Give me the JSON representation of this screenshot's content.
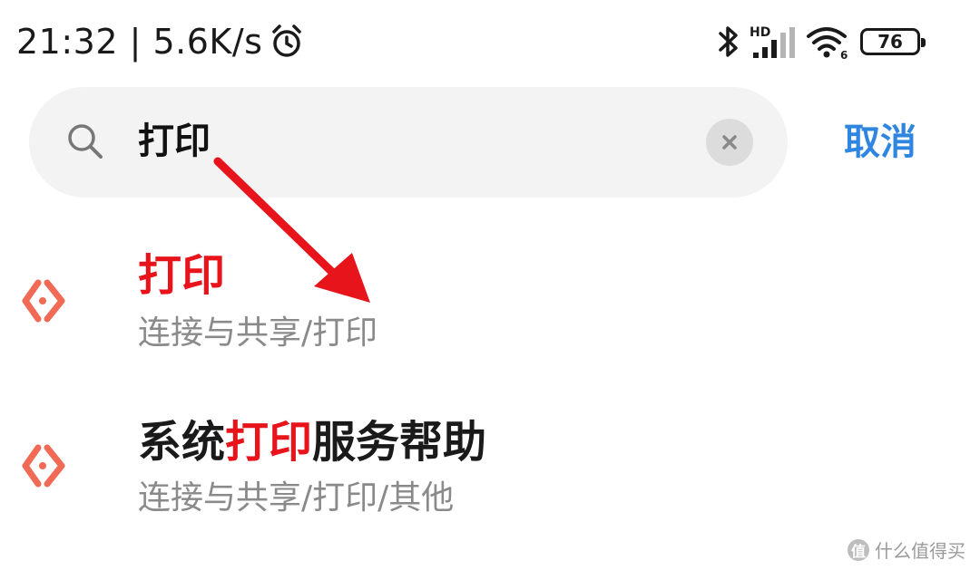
{
  "status_bar": {
    "time": "21:32",
    "network_speed": "5.6K/s",
    "battery": "76",
    "network_label": "HD",
    "wifi_label": "6",
    "icons": [
      "alarm-icon",
      "bluetooth-icon",
      "hd-signal-icon",
      "wifi-icon",
      "battery-icon"
    ]
  },
  "search": {
    "value": "打印",
    "cancel_label": "取消",
    "icons": [
      "search-icon",
      "clear-icon"
    ]
  },
  "results": [
    {
      "title_before": "",
      "title_highlight": "打印",
      "title_after": "",
      "path": "连接与共享/打印",
      "icon": "share-connect-icon"
    },
    {
      "title_before": "系统",
      "title_highlight": "打印",
      "title_after": "服务帮助",
      "path": "连接与共享/打印/其他",
      "icon": "share-connect-icon"
    }
  ],
  "watermark": {
    "text": "什么值得买",
    "logo": "值"
  },
  "colors": {
    "highlight": "#e8141c",
    "accent": "#2f86e0",
    "icon": "#f06a55",
    "arrow": "#e8141c",
    "search_bg": "#f3f3f3",
    "subtext": "#8a8a8a"
  }
}
